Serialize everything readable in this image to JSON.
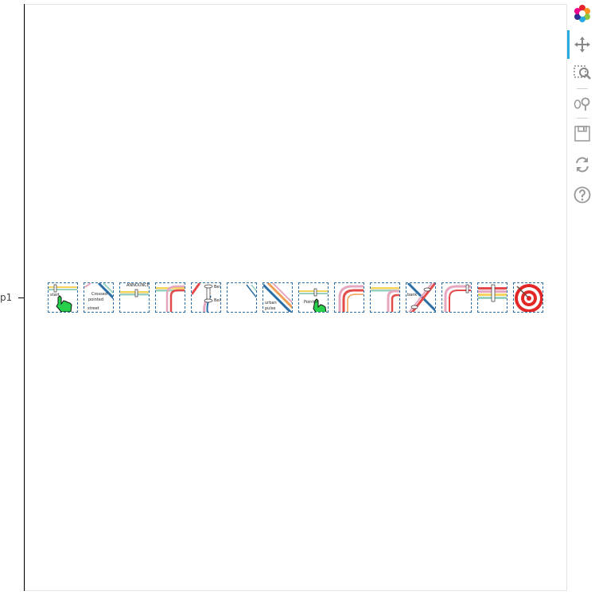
{
  "y_axis": {
    "tick_label": "p1"
  },
  "toolbar": {
    "tools": [
      {
        "name": "bokeh-logo",
        "active": false
      },
      {
        "name": "pan-tool",
        "active": true
      },
      {
        "name": "box-zoom-tool",
        "active": false
      },
      {
        "name": "wheel-zoom-tool",
        "active": false
      },
      {
        "name": "save-tool",
        "active": false
      },
      {
        "name": "reset-tool",
        "active": false
      },
      {
        "name": "help-tool",
        "active": false
      }
    ]
  },
  "tiles": [
    {
      "name": "tile-hand-start",
      "text": "start"
    },
    {
      "name": "tile-crossed-diagonal",
      "text_lines": [
        "Crossed",
        "pointed"
      ],
      "bottom_text": "street"
    },
    {
      "name": "tile-labeled-bar",
      "text": "ANNOUNCE"
    },
    {
      "name": "tile-corner-colored",
      "text": ""
    },
    {
      "name": "tile-bridge-markers",
      "text_lines": [
        "Bel",
        "Bel"
      ]
    },
    {
      "name": "tile-thin-diagonal",
      "text": ""
    },
    {
      "name": "tile-diagonal-labeled",
      "text_lines": [
        "urban",
        "pulse"
      ]
    },
    {
      "name": "tile-hand-pointer",
      "text": "Pointer"
    },
    {
      "name": "tile-curve-red",
      "text": ""
    },
    {
      "name": "tile-curve-pink",
      "text": ""
    },
    {
      "name": "tile-crossing-x",
      "text": "bank"
    },
    {
      "name": "tile-curve-pink-corner",
      "text": ""
    },
    {
      "name": "tile-stripes-station",
      "text": ""
    },
    {
      "name": "tile-target",
      "text": ""
    }
  ]
}
